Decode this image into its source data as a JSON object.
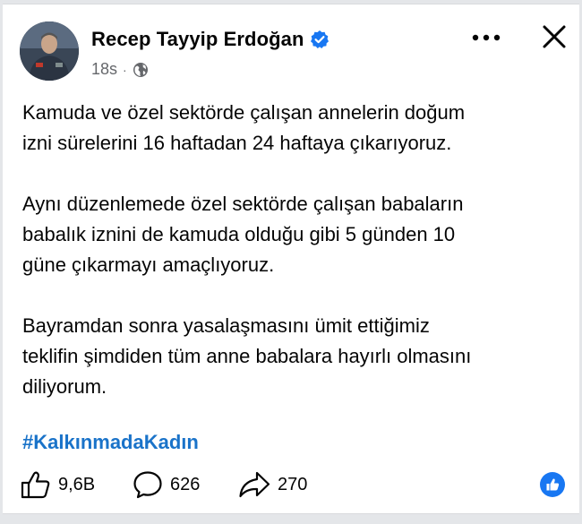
{
  "post": {
    "author": "Recep Tayyip Erdoğan",
    "time": "18s",
    "separator": "·",
    "paragraphs": [
      "Kamuda ve özel sektörde çalışan annelerin doğum\nizni sürelerini 16 haftadan 24 haftaya çıkarıyoruz.",
      "Aynı düzenlemede özel sektörde çalışan babaların\nbabalık iznini de kamuda olduğu gibi 5 günden 10\ngüne çıkarmayı amaçlıyoruz.",
      "Bayramdan sonra yasalaşmasını ümit ettiğimiz\nteklifin şimdiden tüm anne babalara hayırlı olmasını\ndiliyorum."
    ],
    "hashtag": "#KalkınmadaKadın"
  },
  "footer": {
    "likes": "9,6B",
    "comments": "626",
    "shares": "270"
  },
  "colors": {
    "hashtag": "#1a73c9",
    "verified": "#1877f2",
    "muted": "#65676b",
    "like_badge": "#1877f2"
  },
  "icons": {
    "more": "more-horizontal-icon",
    "close": "close-icon",
    "verified": "verified-badge-icon",
    "audience": "globe-icon",
    "like": "thumbs-up-icon",
    "comment": "comment-bubble-icon",
    "share": "share-arrow-icon",
    "reaction": "like-reaction-icon"
  }
}
